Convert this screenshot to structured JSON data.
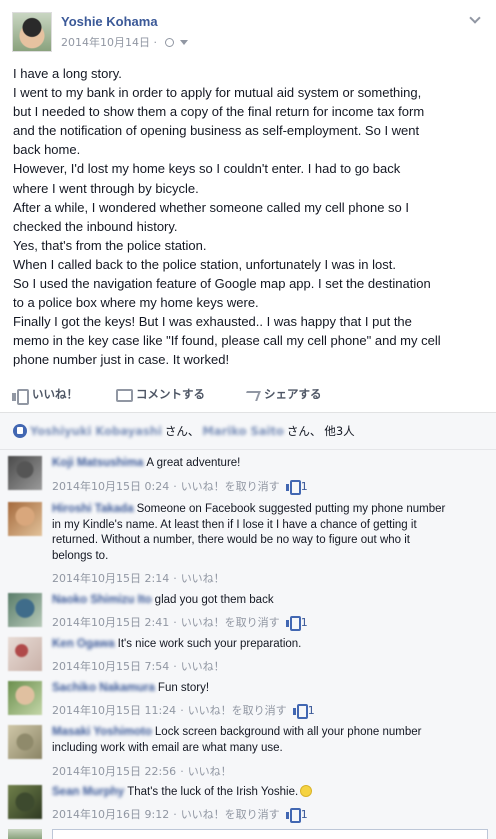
{
  "post": {
    "author": "Yoshie Kohama",
    "date": "2014年10月14日",
    "date_sep": "·",
    "privacy_icon": "globe-icon",
    "menu_icon": "chevron-down-icon",
    "lines": [
      "I have a long story.",
      "I went to my bank in order to apply for mutual aid system or something,",
      "but I needed to show them a copy of the final return for income tax form",
      "and the notification of opening business as self-employment. So I went",
      "back home.",
      "However, I'd lost my home keys so I couldn't enter. I had to go back",
      "where I went through by bicycle.",
      "After a while, I wondered whether someone called my cell phone so I",
      "checked the inbound history.",
      "Yes, that's from the police station.",
      "When I called back to the police station, unfortunately I was in lost.",
      "So I used the navigation feature of Google map app. I set the destination",
      "to a police box where my home keys were.",
      "Finally I got the keys! But I was exhausted.. I was happy that I put the",
      "memo in the key case like \"If found, please call my cell phone\" and my cell",
      "phone number just in case. It worked!"
    ]
  },
  "actions": {
    "like": "いいね！",
    "comment": "コメントする",
    "share": "シェアする"
  },
  "likes_summary": {
    "name1": "Yoshiyuki Kobayashi",
    "san1": "さん、",
    "name2": "Mariko Saito",
    "san2": "さん、",
    "others": "他3人"
  },
  "comments": [
    {
      "name": "Koji Matsushima",
      "lines": [
        "A great adventure!"
      ],
      "timestamp": "2014年10月15日 0:24",
      "like_link": "いいね！を取り消す",
      "like_count": "1"
    },
    {
      "name": "Hiroshi Takada",
      "lines": [
        "Someone on Facebook suggested putting my phone number",
        "in my Kindle's name. At least then if I lose it I have a chance of getting it",
        "returned. Without a number, there would be no way to figure out who it",
        "belongs to."
      ],
      "timestamp": "2014年10月15日 2:14",
      "like_link": "いいね！",
      "like_count": ""
    },
    {
      "name": "Naoko Shimizu Ito",
      "lines": [
        "glad you got them back"
      ],
      "timestamp": "2014年10月15日 2:41",
      "like_link": "いいね！を取り消す",
      "like_count": "1"
    },
    {
      "name": "Ken Ogawa",
      "lines": [
        "It's nice work such your preparation."
      ],
      "timestamp": "2014年10月15日 7:54",
      "like_link": "いいね！",
      "like_count": ""
    },
    {
      "name": "Sachiko Nakamura",
      "lines": [
        "Fun story!"
      ],
      "timestamp": "2014年10月15日 11:24",
      "like_link": "いいね！を取り消す",
      "like_count": "1"
    },
    {
      "name": "Masaki Yoshimoto",
      "lines": [
        "Lock screen background with all your phone number",
        "including work with email are what many use."
      ],
      "timestamp": "2014年10月15日 22:56",
      "like_link": "いいね！",
      "like_count": ""
    },
    {
      "name": "Sean Murphy",
      "lines": [
        "That's the luck of the Irish Yoshie."
      ],
      "emoji": "smile-icon",
      "timestamp": "2014年10月16日 9:12",
      "like_link": "いいね！を取り消す",
      "like_count": "1"
    }
  ],
  "colors": {
    "link_blue": "#3b5998",
    "meta_gray": "#9197a3",
    "comments_bg": "#f6f7f9"
  }
}
